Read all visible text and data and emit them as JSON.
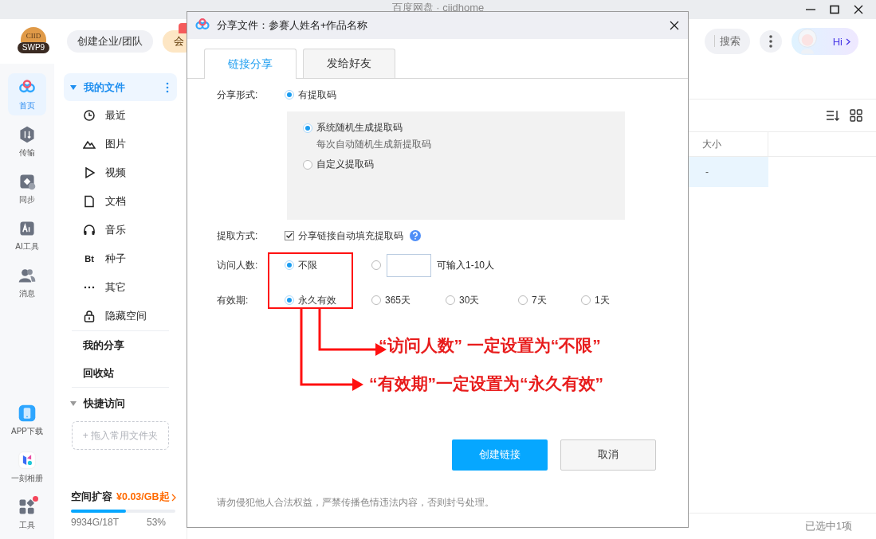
{
  "window": {
    "title": "百度网盘 · ciidhome"
  },
  "header": {
    "logo": {
      "top": "CIID",
      "bottom": "SWP9"
    },
    "create_team_button": "创建企业/团队",
    "vip_button": {
      "label": "会",
      "badge": true
    },
    "search_button": "搜索",
    "assistant_label": "Hi"
  },
  "rail": {
    "top": [
      {
        "label": "首页",
        "selected": true
      },
      {
        "label": "传输",
        "selected": false
      },
      {
        "label": "同步",
        "selected": false
      },
      {
        "label": "AI工具",
        "selected": false
      },
      {
        "label": "消息",
        "selected": false
      }
    ],
    "bottom": [
      {
        "label": "APP下载",
        "badge": false
      },
      {
        "label": "一刻相册",
        "badge": false
      },
      {
        "label": "工具",
        "badge": true
      }
    ]
  },
  "sidebar": {
    "my_files": {
      "label": "我的文件",
      "expanded": true,
      "selected": true,
      "children": [
        {
          "label": "最近"
        },
        {
          "label": "图片"
        },
        {
          "label": "视频"
        },
        {
          "label": "文档"
        },
        {
          "label": "音乐"
        },
        {
          "label": "种子",
          "glyph": "Bt"
        },
        {
          "label": "其它"
        },
        {
          "label": "隐藏空间"
        }
      ]
    },
    "links": [
      "我的分享",
      "回收站"
    ],
    "quick_access": {
      "label": "快捷访问",
      "expanded": true,
      "drop_hint": "+ 拖入常用文件夹"
    },
    "storage": {
      "label": "空间扩容",
      "price": "¥0.03/GB起",
      "usage": "9934G/18T",
      "percent": "53%",
      "level": 0.53
    }
  },
  "file_list": {
    "columns": [
      "大小"
    ],
    "rows": [
      {
        "size": "-",
        "selected": true
      }
    ]
  },
  "status_bar": "已选中1项",
  "dialog": {
    "title": "分享文件：参赛人姓名+作品名称",
    "tabs": [
      {
        "label": "链接分享",
        "selected": true
      },
      {
        "label": "发给好友",
        "selected": false
      }
    ],
    "share_form": {
      "label": "分享形式:",
      "option": {
        "label": "有提取码",
        "selected": true
      }
    },
    "code_options": [
      {
        "label": "系统随机生成提取码",
        "description": "每次自动随机生成新提取码",
        "selected": true
      },
      {
        "label": "自定义提取码",
        "selected": false
      }
    ],
    "extract_method": {
      "label": "提取方式:",
      "option": {
        "label": "分享链接自动填充提取码",
        "checked": true
      }
    },
    "visitors": {
      "label": "访问人数:",
      "options": [
        {
          "kind": "plain",
          "label": "不限",
          "selected": true
        },
        {
          "kind": "input",
          "label": "可输入1-10人",
          "selected": false
        }
      ]
    },
    "validity": {
      "label": "有效期:",
      "options": [
        {
          "label": "永久有效",
          "selected": true
        },
        {
          "label": "365天",
          "selected": false
        },
        {
          "label": "30天",
          "selected": false
        },
        {
          "label": "7天",
          "selected": false
        },
        {
          "label": "1天",
          "selected": false
        }
      ]
    },
    "buttons": {
      "primary": "创建链接",
      "secondary": "取消"
    },
    "footer": "请勿侵犯他人合法权益，严禁传播色情违法内容，否则封号处理。"
  },
  "annotations": [
    "“访问人数” 一定设置为“不限”",
    "“有效期”一定设置为“永久有效”"
  ]
}
